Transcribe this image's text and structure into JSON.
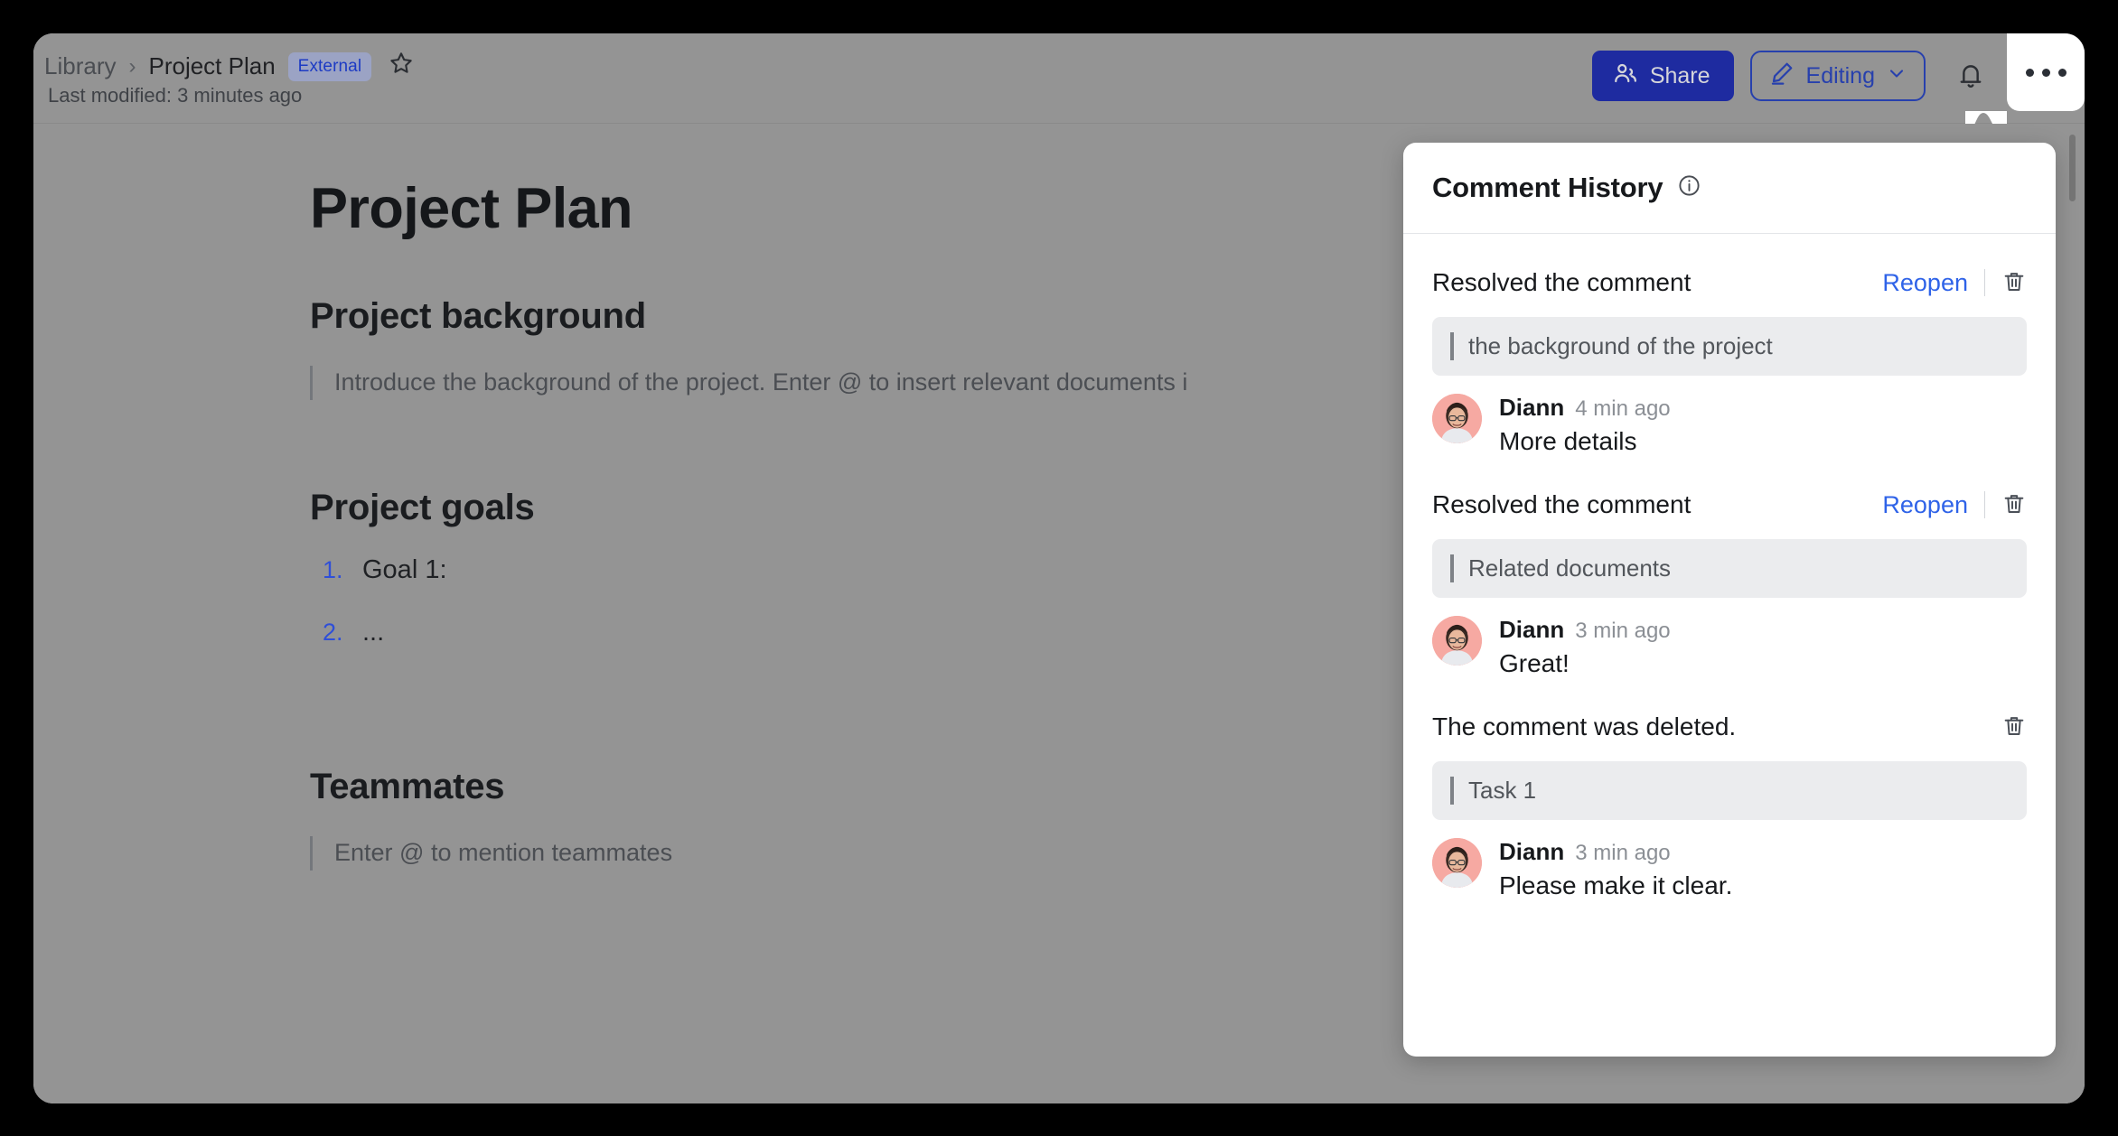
{
  "header": {
    "breadcrumb": {
      "parent": "Library",
      "separator": "›",
      "current": "Project Plan"
    },
    "badge": "External",
    "star_icon": "star-icon",
    "last_modified": "Last modified: 3 minutes ago"
  },
  "toolbar": {
    "share_label": "Share",
    "share_icon": "people-icon",
    "share_color": "#1e2ba0",
    "editing_label": "Editing",
    "editing_icon": "pencil-icon",
    "editing_chevron": "chevron-down-icon",
    "editing_color": "#2740ad",
    "bell_icon": "bell-icon",
    "more_icon": "more-horizontal-icon"
  },
  "document": {
    "title": "Project Plan",
    "sections": [
      {
        "heading": "Project background",
        "placeholder": "Introduce the background of the project. Enter @ to insert relevant documents i"
      },
      {
        "heading": "Project goals",
        "items": [
          {
            "num": "1.",
            "text": "Goal 1:"
          },
          {
            "num": "2.",
            "text": "..."
          }
        ]
      },
      {
        "heading": "Teammates",
        "placeholder": "Enter @ to mention teammates"
      }
    ]
  },
  "comment_panel": {
    "title": "Comment History",
    "info_icon": "info-icon",
    "entries": [
      {
        "action": "Resolved the comment",
        "reopen_label": "Reopen",
        "has_reopen": true,
        "delete_icon": "trash-icon",
        "quote": "the background of the project",
        "author": "Diann",
        "time": "4 min ago",
        "text": "More details"
      },
      {
        "action": "Resolved the comment",
        "reopen_label": "Reopen",
        "has_reopen": true,
        "delete_icon": "trash-icon",
        "quote": "Related documents",
        "author": "Diann",
        "time": "3 min ago",
        "text": "Great!"
      },
      {
        "action": "The comment was deleted.",
        "reopen_label": "",
        "has_reopen": false,
        "delete_icon": "trash-icon",
        "quote": "Task 1",
        "author": "Diann",
        "time": "3 min ago",
        "text": "Please make it clear."
      }
    ]
  }
}
